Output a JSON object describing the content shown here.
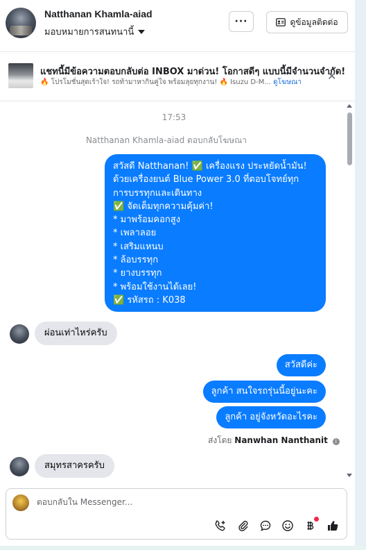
{
  "header": {
    "contact_name": "Natthanan Khamla-aiad",
    "assign_label": "มอบหมายการสนทนานี้",
    "more_label": "···",
    "contact_info_label": "ดูข้อมูลติดต่อ"
  },
  "ad": {
    "title": "แชทนี้มีข้อความตอบกลับต่อ INBOX มาด่วน! โอกาสดีๆ แบบนี้มีจำนวนจำกัด!",
    "subtitle": "🔥 โปรโมชั่นสุดเร้าใจ! รถท้ามาหากินคู่ใจ พร้อมลุยทุกงาน! 🔥 Isuzu D-M...",
    "link_label": "ดูโฆษณา",
    "close_label": "✕"
  },
  "chat": {
    "time": "17:53",
    "reply_note": "Natthanan Khamla-aiad ตอบกลับโฆษณา",
    "ad_message_lines": [
      "สวัสดี Natthanan! ✅ เครื่องแรง ประหยัดน้ำมัน!",
      "ด้วยเครื่องยนต์ Blue Power 3.0 ที่ตอบโจทย์ทุก",
      "การบรรทุกและเดินทาง",
      "✅ จัดเต็มทุกความคุ้มค่า!",
      "* มาพร้อมคอกสูง",
      "* เพลาลอย",
      "* เสริมแหนบ",
      "* ล้อบรรทุก",
      "* ยางบรรทุก",
      "* พร้อมใช้งานได้เลย!",
      "✅ รหัสรถ : K038"
    ],
    "incoming_1": "ผ่อนเท่าไหร่ครับ",
    "outgoing_1": "สวัสดีค่ะ",
    "outgoing_2": "ลูกค้า สนใจรถรุ่นนี้อยู่นะคะ",
    "outgoing_3": "ลูกค้า อยู่จังหวัดอะไรคะ",
    "sent_by_prefix": "ส่งโดย",
    "sent_by_name": "Nanwhan Nanthanit",
    "incoming_2": "สมุทรสาครครับ"
  },
  "composer": {
    "placeholder": "ตอบกลับใน Messenger...",
    "tools": [
      "phone-add-icon",
      "attachment-icon",
      "saved-replies-icon",
      "emoji-icon",
      "coin-icon",
      "thumbs-up-icon"
    ]
  },
  "colors": {
    "messenger_blue": "#0a7cff",
    "incoming_gray": "#e4e6eb",
    "link_blue": "#216fdb"
  }
}
